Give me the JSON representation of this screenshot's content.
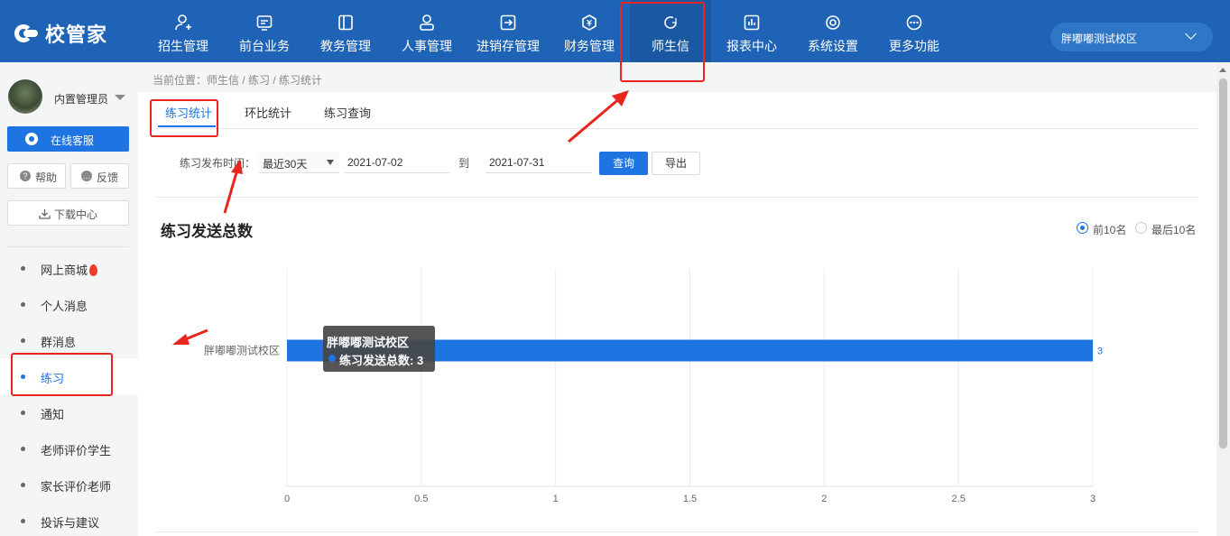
{
  "app": {
    "logo_text": "校管家"
  },
  "topnav": {
    "items": [
      {
        "label": "招生管理",
        "icon": "person-add-icon"
      },
      {
        "label": "前台业务",
        "icon": "desk-icon"
      },
      {
        "label": "教务管理",
        "icon": "book-icon"
      },
      {
        "label": "人事管理",
        "icon": "person-icon"
      },
      {
        "label": "进销存管理",
        "icon": "inventory-icon"
      },
      {
        "label": "财务管理",
        "icon": "yuan-icon"
      },
      {
        "label": "师生信",
        "icon": "chat-icon",
        "active": true
      },
      {
        "label": "报表中心",
        "icon": "report-icon"
      },
      {
        "label": "系统设置",
        "icon": "settings-icon"
      },
      {
        "label": "更多功能",
        "icon": "more-icon"
      }
    ],
    "campus": "胖嘟嘟测试校区"
  },
  "sidebar": {
    "user_name": "内置管理员",
    "service_button": "在线客服",
    "help_button": "帮助",
    "feedback_button": "反馈",
    "download_button": "下载中心",
    "items": [
      {
        "label": "网上商城"
      },
      {
        "label": "个人消息"
      },
      {
        "label": "群消息"
      },
      {
        "label": "练习",
        "active": true
      },
      {
        "label": "通知"
      },
      {
        "label": "老师评价学生"
      },
      {
        "label": "家长评价老师"
      },
      {
        "label": "投诉与建议"
      }
    ]
  },
  "breadcrumb": "当前位置：师生信 / 练习 / 练习统计",
  "tabs": [
    {
      "label": "练习统计",
      "active": true
    },
    {
      "label": "环比统计"
    },
    {
      "label": "练习查询"
    }
  ],
  "filter": {
    "label": "练习发布时间：",
    "range_select": "最近30天",
    "start_date": "2021-07-02",
    "to_label": "到",
    "end_date": "2021-07-31",
    "query_button": "查询",
    "export_button": "导出"
  },
  "chart_section": {
    "title": "练习发送总数",
    "radio_top10": "前10名",
    "radio_last10": "最后10名",
    "radio_selected": "前10名"
  },
  "chart_data": {
    "type": "bar",
    "orientation": "horizontal",
    "categories": [
      "胖嘟嘟测试校区"
    ],
    "series": [
      {
        "name": "练习发送总数",
        "values": [
          3
        ]
      }
    ],
    "xlim": [
      0,
      3
    ],
    "xticks": [
      "0",
      "0.5",
      "1",
      "1.5",
      "2",
      "2.5",
      "3"
    ],
    "data_labels": [
      "3"
    ],
    "grid": true,
    "bar_color": "#1e74e0"
  },
  "tooltip": {
    "title": "胖嘟嘟测试校区",
    "text": "练习发送总数: 3"
  },
  "colors": {
    "nav_bg": "#1e63b5",
    "accent": "#1e74e0",
    "annotation": "#e8261d"
  }
}
